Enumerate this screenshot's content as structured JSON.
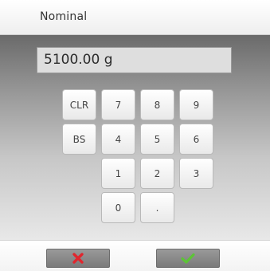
{
  "title": "Nominal",
  "input": {
    "value": "5100.00 g"
  },
  "keypad": {
    "clr": "CLR",
    "bs": "BS",
    "k7": "7",
    "k8": "8",
    "k9": "9",
    "k4": "4",
    "k5": "5",
    "k6": "6",
    "k1": "1",
    "k2": "2",
    "k3": "3",
    "k0": "0",
    "dot": "."
  },
  "actions": {
    "cancel_icon": "red-x-icon",
    "confirm_icon": "green-checkmark-icon",
    "cancel_color": "#e0262e",
    "confirm_color": "#5cc436"
  }
}
